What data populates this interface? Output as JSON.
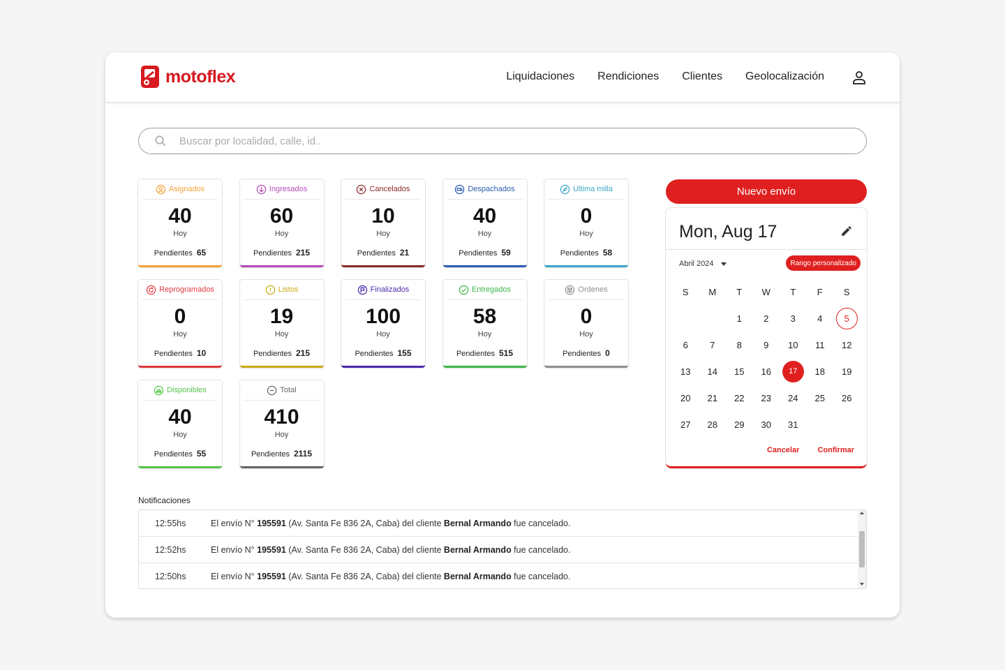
{
  "brand": {
    "name": "motoflex",
    "color": "#d71920"
  },
  "nav": [
    "Liquidaciones",
    "Rendiciones",
    "Clientes",
    "Geolocalización"
  ],
  "search": {
    "placeholder": "Buscar por localidad, calle, id..",
    "value": ""
  },
  "cards": [
    {
      "label": "Asignados",
      "value": "40",
      "hoy": "Hoy",
      "pend_label": "Pendientes",
      "pend": "65",
      "color": "#f3a23a",
      "icon": "user-circle-icon"
    },
    {
      "label": "Ingresados",
      "value": "60",
      "hoy": "Hoy",
      "pend_label": "Pendientes",
      "pend": "215",
      "color": "#b44bb8",
      "icon": "arrow-down-circle-icon"
    },
    {
      "label": "Cancelados",
      "value": "10",
      "hoy": "Hoy",
      "pend_label": "Pendientes",
      "pend": "21",
      "color": "#8b2b2b",
      "icon": "x-circle-icon"
    },
    {
      "label": "Despachados",
      "value": "40",
      "hoy": "Hoy",
      "pend_label": "Pendientes",
      "pend": "59",
      "color": "#2a5db0",
      "icon": "truck-circle-icon"
    },
    {
      "label": "Ultima milla",
      "value": "0",
      "hoy": "Hoy",
      "pend_label": "Pendientes",
      "pend": "58",
      "color": "#3aa6c9",
      "icon": "compass-icon"
    },
    {
      "label": "Reprogramados",
      "value": "0",
      "hoy": "Hoy",
      "pend_label": "Pendientes",
      "pend": "10",
      "color": "#e0393e",
      "icon": "refresh-circle-icon"
    },
    {
      "label": "Listos",
      "value": "19",
      "hoy": "Hoy",
      "pend_label": "Pendientes",
      "pend": "215",
      "color": "#c9a90f",
      "icon": "alert-circle-icon"
    },
    {
      "label": "Finalizados",
      "value": "100",
      "hoy": "Hoy",
      "pend_label": "Pendientes",
      "pend": "155",
      "color": "#4a2aa8",
      "icon": "flag-circle-icon"
    },
    {
      "label": "Entregados",
      "value": "58",
      "hoy": "Hoy",
      "pend_label": "Pendientes",
      "pend": "515",
      "color": "#3db54a",
      "icon": "check-circle-icon"
    },
    {
      "label": "Ordenes",
      "value": "0",
      "hoy": "Hoy",
      "pend_label": "Pendientes",
      "pend": "0",
      "color": "#8e8e8e",
      "icon": "box-circle-icon"
    },
    {
      "label": "Disponibles",
      "value": "40",
      "hoy": "Hoy",
      "pend_label": "Pendientes",
      "pend": "55",
      "color": "#56c34a",
      "icon": "bike-circle-icon"
    },
    {
      "label": "Total",
      "value": "410",
      "hoy": "Hoy",
      "pend_label": "Pendientes",
      "pend": "2115",
      "color": "#666666",
      "icon": "minus-circle-icon"
    }
  ],
  "nuevo_label": "Nuevo envío",
  "calendar": {
    "date_title": "Mon, Aug 17",
    "month_label": "Abril 2024",
    "range_label": "Rango personalizado",
    "dows": [
      "S",
      "M",
      "T",
      "W",
      "T",
      "F",
      "S"
    ],
    "days": [
      "",
      "",
      "1",
      "2",
      "3",
      "4",
      "5",
      "6",
      "7",
      "8",
      "9",
      "10",
      "11",
      "12",
      "13",
      "14",
      "15",
      "16",
      "17",
      "18",
      "19",
      "20",
      "21",
      "22",
      "23",
      "24",
      "25",
      "26",
      "27",
      "28",
      "29",
      "30",
      "31"
    ],
    "today": "5",
    "selected": "17",
    "cancel_label": "Cancelar",
    "confirm_label": "Confirmar"
  },
  "notifications": {
    "title": "Notificaciones",
    "rows": [
      {
        "time": "12:55hs",
        "pre": "El envío N° ",
        "id": "195591",
        "mid": " (Av. Santa Fe 836 2A, Caba) del cliente ",
        "client": "Bernal Armando",
        "post": " fue cancelado."
      },
      {
        "time": "12:52hs",
        "pre": "El envío N° ",
        "id": "195591",
        "mid": " (Av. Santa Fe 836 2A, Caba) del cliente ",
        "client": "Bernal Armando",
        "post": " fue cancelado."
      },
      {
        "time": "12:50hs",
        "pre": "El envío N° ",
        "id": "195591",
        "mid": " (Av. Santa Fe 836 2A, Caba) del cliente ",
        "client": "Bernal Armando",
        "post": " fue cancelado."
      }
    ]
  }
}
